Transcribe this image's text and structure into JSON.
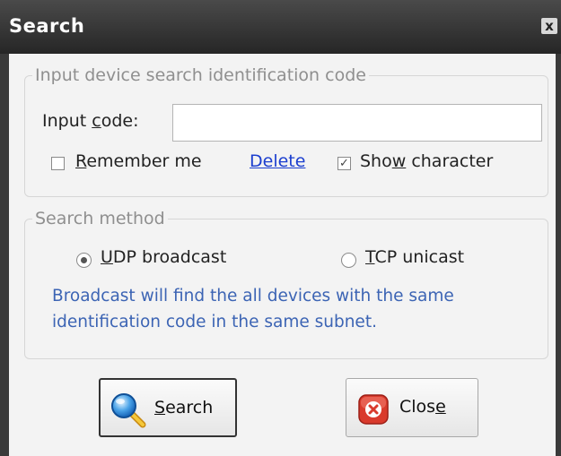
{
  "window": {
    "title": "Search",
    "close_glyph": "x"
  },
  "code_group": {
    "legend": "Input device search identification code",
    "input_label": {
      "before": "Input ",
      "mnemonic": "c",
      "after": "ode:"
    },
    "input_value": "",
    "remember": {
      "mnemonic": "R",
      "after": "emember me",
      "checked": false
    },
    "delete_link": "Delete",
    "show_character": {
      "before": "Sho",
      "mnemonic": "w",
      "after": " character",
      "checked": true,
      "check_glyph": "✓"
    }
  },
  "method_group": {
    "legend": "Search method",
    "udp": {
      "mnemonic": "U",
      "after": "DP broadcast",
      "selected": true
    },
    "tcp": {
      "mnemonic": "T",
      "after": "CP unicast",
      "selected": false
    },
    "info_line1": "Broadcast will find the all devices with the same",
    "info_line2": "identification code in the same subnet."
  },
  "buttons": {
    "search": {
      "mnemonic": "S",
      "after": "earch",
      "icon": "magnifier-icon"
    },
    "close": {
      "before": "Clos",
      "mnemonic": "e",
      "icon": "close-x-icon"
    }
  },
  "colors": {
    "link": "#1c3fcf",
    "info_text": "#3c64b4",
    "close_icon_red": "#d93a2c"
  }
}
